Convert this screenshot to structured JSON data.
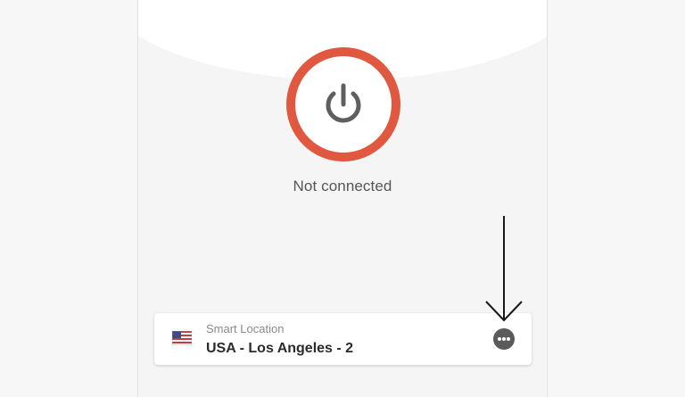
{
  "status": {
    "text": "Not connected",
    "state_color": "#e0583f"
  },
  "location": {
    "label": "Smart Location",
    "name": "USA - Los Angeles - 2",
    "flag_icon": "us-flag-icon"
  },
  "icons": {
    "power": "power-icon",
    "more": "more-options-icon",
    "annotation": "arrow-down-icon"
  }
}
